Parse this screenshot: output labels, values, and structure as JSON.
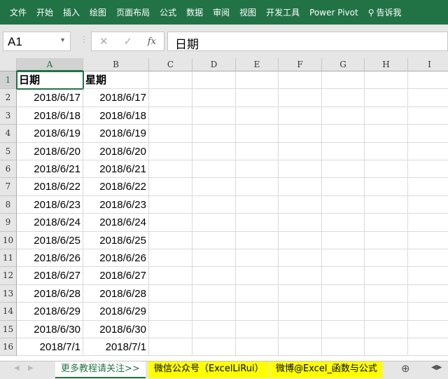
{
  "ribbon": {
    "tabs": [
      "文件",
      "开始",
      "插入",
      "绘图",
      "页面布局",
      "公式",
      "数据",
      "审阅",
      "视图",
      "开发工具",
      "Power Pivot"
    ],
    "tell_me": "告诉我"
  },
  "formula_bar": {
    "name_box": "A1",
    "content": "日期",
    "fx": "fx",
    "cancel": "✕",
    "enter": "✓"
  },
  "columns": [
    "A",
    "B",
    "C",
    "D",
    "E",
    "F",
    "G",
    "H",
    "I"
  ],
  "rows": [
    [
      "日期",
      "星期"
    ],
    [
      "2018/6/17",
      "2018/6/17"
    ],
    [
      "2018/6/18",
      "2018/6/18"
    ],
    [
      "2018/6/19",
      "2018/6/19"
    ],
    [
      "2018/6/20",
      "2018/6/20"
    ],
    [
      "2018/6/21",
      "2018/6/21"
    ],
    [
      "2018/6/22",
      "2018/6/22"
    ],
    [
      "2018/6/23",
      "2018/6/23"
    ],
    [
      "2018/6/24",
      "2018/6/24"
    ],
    [
      "2018/6/25",
      "2018/6/25"
    ],
    [
      "2018/6/26",
      "2018/6/26"
    ],
    [
      "2018/6/27",
      "2018/6/27"
    ],
    [
      "2018/6/28",
      "2018/6/28"
    ],
    [
      "2018/6/29",
      "2018/6/29"
    ],
    [
      "2018/6/30",
      "2018/6/30"
    ],
    [
      "2018/7/1",
      "2018/7/1"
    ]
  ],
  "sheets": [
    {
      "label": "更多教程请关注>>",
      "active": true
    },
    {
      "label": "微信公众号（ExcelLiRui）",
      "highlight": "#ffff00"
    },
    {
      "label": "微博@Excel_函数与公式",
      "highlight": "#ffff00"
    }
  ],
  "colors": {
    "accent": "#217346"
  }
}
